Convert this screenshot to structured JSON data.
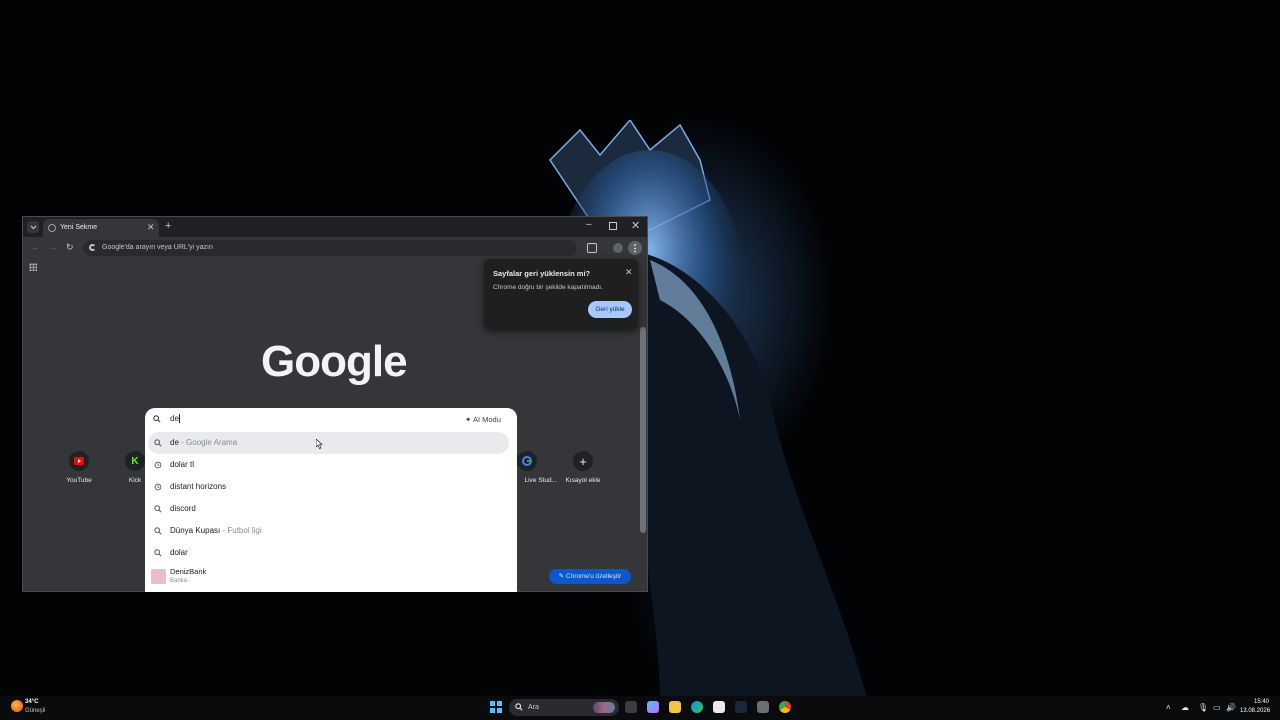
{
  "browser": {
    "tab_title": "Yeni Sekme",
    "omnibox_placeholder": "Google'da arayın veya URL'yi yazın",
    "logo_text": "Google",
    "customize_label": "Chrome'u özelleştir"
  },
  "shortcuts": [
    {
      "label": "YouTube",
      "icon": "youtube-icon",
      "color": "#ff0000"
    },
    {
      "label": "Kick",
      "icon": "kick-icon",
      "color": "#53fc18"
    },
    {
      "label": "Live Stud...",
      "icon": "google-icon",
      "color": "#4285f4"
    },
    {
      "label": "Kısayol ekle",
      "icon": "plus-icon",
      "color": "#e8eaed"
    }
  ],
  "restore_popup": {
    "title": "Sayfalar geri yüklensin mi?",
    "message": "Chrome doğru bir şekilde kapatılmadı.",
    "button": "Geri yükle"
  },
  "dropdown": {
    "input_value": "de",
    "ai_mode_label": "AI Modu",
    "suggestions": [
      {
        "text": "de",
        "sub": " - Google Arama",
        "icon": "search-icon",
        "selected": true
      },
      {
        "text": "dolar tl",
        "sub": "",
        "icon": "history-icon",
        "selected": false
      },
      {
        "text": "distant horizons",
        "sub": "",
        "icon": "history-icon",
        "selected": false
      },
      {
        "text": "discord",
        "sub": "",
        "icon": "search-icon",
        "selected": false
      },
      {
        "text": "Dünya Kupası",
        "sub": " - Futbol ligi",
        "icon": "search-icon",
        "selected": false
      },
      {
        "text": "dolar",
        "sub": "",
        "icon": "search-icon",
        "selected": false
      }
    ],
    "entity": {
      "name": "DenizBank",
      "type": "Banka"
    }
  },
  "taskbar": {
    "weather_temp": "34°C",
    "weather_condition": "Güneşli",
    "search_label": "Ara",
    "time": "15:40",
    "date": "13.08.2026"
  },
  "colors": {
    "accent": "#0b57d0",
    "restore_button": "#a8c7fa"
  }
}
